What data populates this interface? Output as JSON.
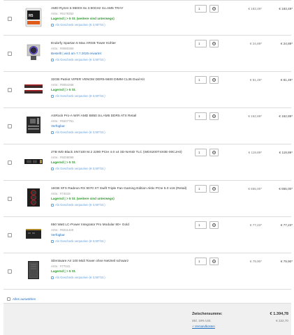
{
  "cart": {
    "items": [
      {
        "name": "AMD Ryzen 5 9600X 6x 3.90GHz So.AM5 TRAY",
        "artno": "Artnr.: #9179352",
        "stock": "Lagernd | > 5 St. (weitere sind unterwegs)",
        "stock_type": "ok",
        "gift": "Als Geschenk verpacken (€ 3,90*/St.)",
        "qty": "1",
        "unit": "€ 183,49*",
        "total": "€ 183,49*",
        "icon": "cpu-box-icon"
      },
      {
        "name": "Endorfy Spartan 5 Max ARGB Tower Kühler",
        "artno": "Artnr.: #9080360",
        "stock": "Bestellt | wird am 7.7.2025 erwartet",
        "stock_type": "blue",
        "gift": "Als Geschenk verpacken (€ 3,90*/St.)",
        "qty": "1",
        "unit": "€ 24,89*",
        "total": "€ 24,89*",
        "icon": "cpu-cooler-icon"
      },
      {
        "name": "32GB Patriot VIPER VENOM DDR5-5600 DIMM CL36 Dual Kit",
        "artno": "Artnr.: #9064268",
        "stock": "Lagernd | > 5 St.",
        "stock_type": "ok",
        "gift": "Als Geschenk verpacken (€ 3,90*/St.)",
        "qty": "1",
        "unit": "€ 81,49*",
        "total": "€ 81,49*",
        "icon": "ram-icon"
      },
      {
        "name": "ASRock Pro-A WiFi AMD B850 So.AM5 DDR5 ATX Retail",
        "artno": "Artnr.: #9207751",
        "stock": "Verfügbar",
        "stock_type": "blue",
        "gift": "Als Geschenk verpacken (€ 3,90*/St.)",
        "qty": "1",
        "unit": "€ 162,89*",
        "total": "€ 162,89*",
        "icon": "motherboard-icon"
      },
      {
        "name": "2TB WD Black SN7100 M.2 2280 PCIe 4.0 x4 3D-NAND TLC (WDS200T4X0E-00CJA0)",
        "artno": "Artnr.: #9209099",
        "stock": "Lagernd | > 5 St.",
        "stock_type": "ok",
        "gift": "Als Geschenk verpacken (€ 3,90*/St.)",
        "qty": "1",
        "unit": "€ 119,89*",
        "total": "€ 119,89*",
        "icon": "ssd-icon"
      },
      {
        "name": "16GB XFX Radeon RX 9070 XT Swift Triple Fan Gaming Edition Aktiv PCIe 5.0 x16 (Retail)",
        "artno": "Artnr.: #74019",
        "stock": "Lagernd | > 5 St. (weitere sind unterwegs)",
        "stock_type": "ok",
        "gift": "Als Geschenk verpacken (€ 3,90*/St.)",
        "qty": "1",
        "unit": "€ 655,00*",
        "total": "€ 655,00*",
        "icon": "gpu-icon"
      },
      {
        "name": "650 Watt LC-Power Integrator Pro Modular 80+ Gold",
        "artno": "Artnr.: #9211440",
        "stock": "Verfügbar",
        "stock_type": "blue",
        "gift": "Als Geschenk verpacken (€ 3,90*/St.)",
        "qty": "1",
        "unit": "€ 77,23*",
        "total": "€ 77,23*",
        "icon": "psu-icon"
      },
      {
        "name": "Silentware Air 100 Midi Tower ohne Netzteil schwarz",
        "artno": "Artnr.: #77041",
        "stock": "Lagernd | > 5 St.",
        "stock_type": "ok",
        "gift": "Als Geschenk verpacken (€ 3,90*/St.)",
        "qty": "1",
        "unit": "€ 79,90*",
        "total": "€ 79,90*",
        "icon": "case-icon"
      }
    ],
    "select_all": "Alles auswählen"
  },
  "summary": {
    "subtotal_label": "Zwischensumme:",
    "subtotal_value": "€ 1.394,78",
    "vat_label": "inkl. 19% USt.",
    "vat_value": "€ 222,70",
    "shipping_label": "+ Versandkosten"
  },
  "colors": {
    "in_stock": "#2d9a2d",
    "link": "#1e6fc2",
    "summary_bg": "#f0f0f0"
  }
}
